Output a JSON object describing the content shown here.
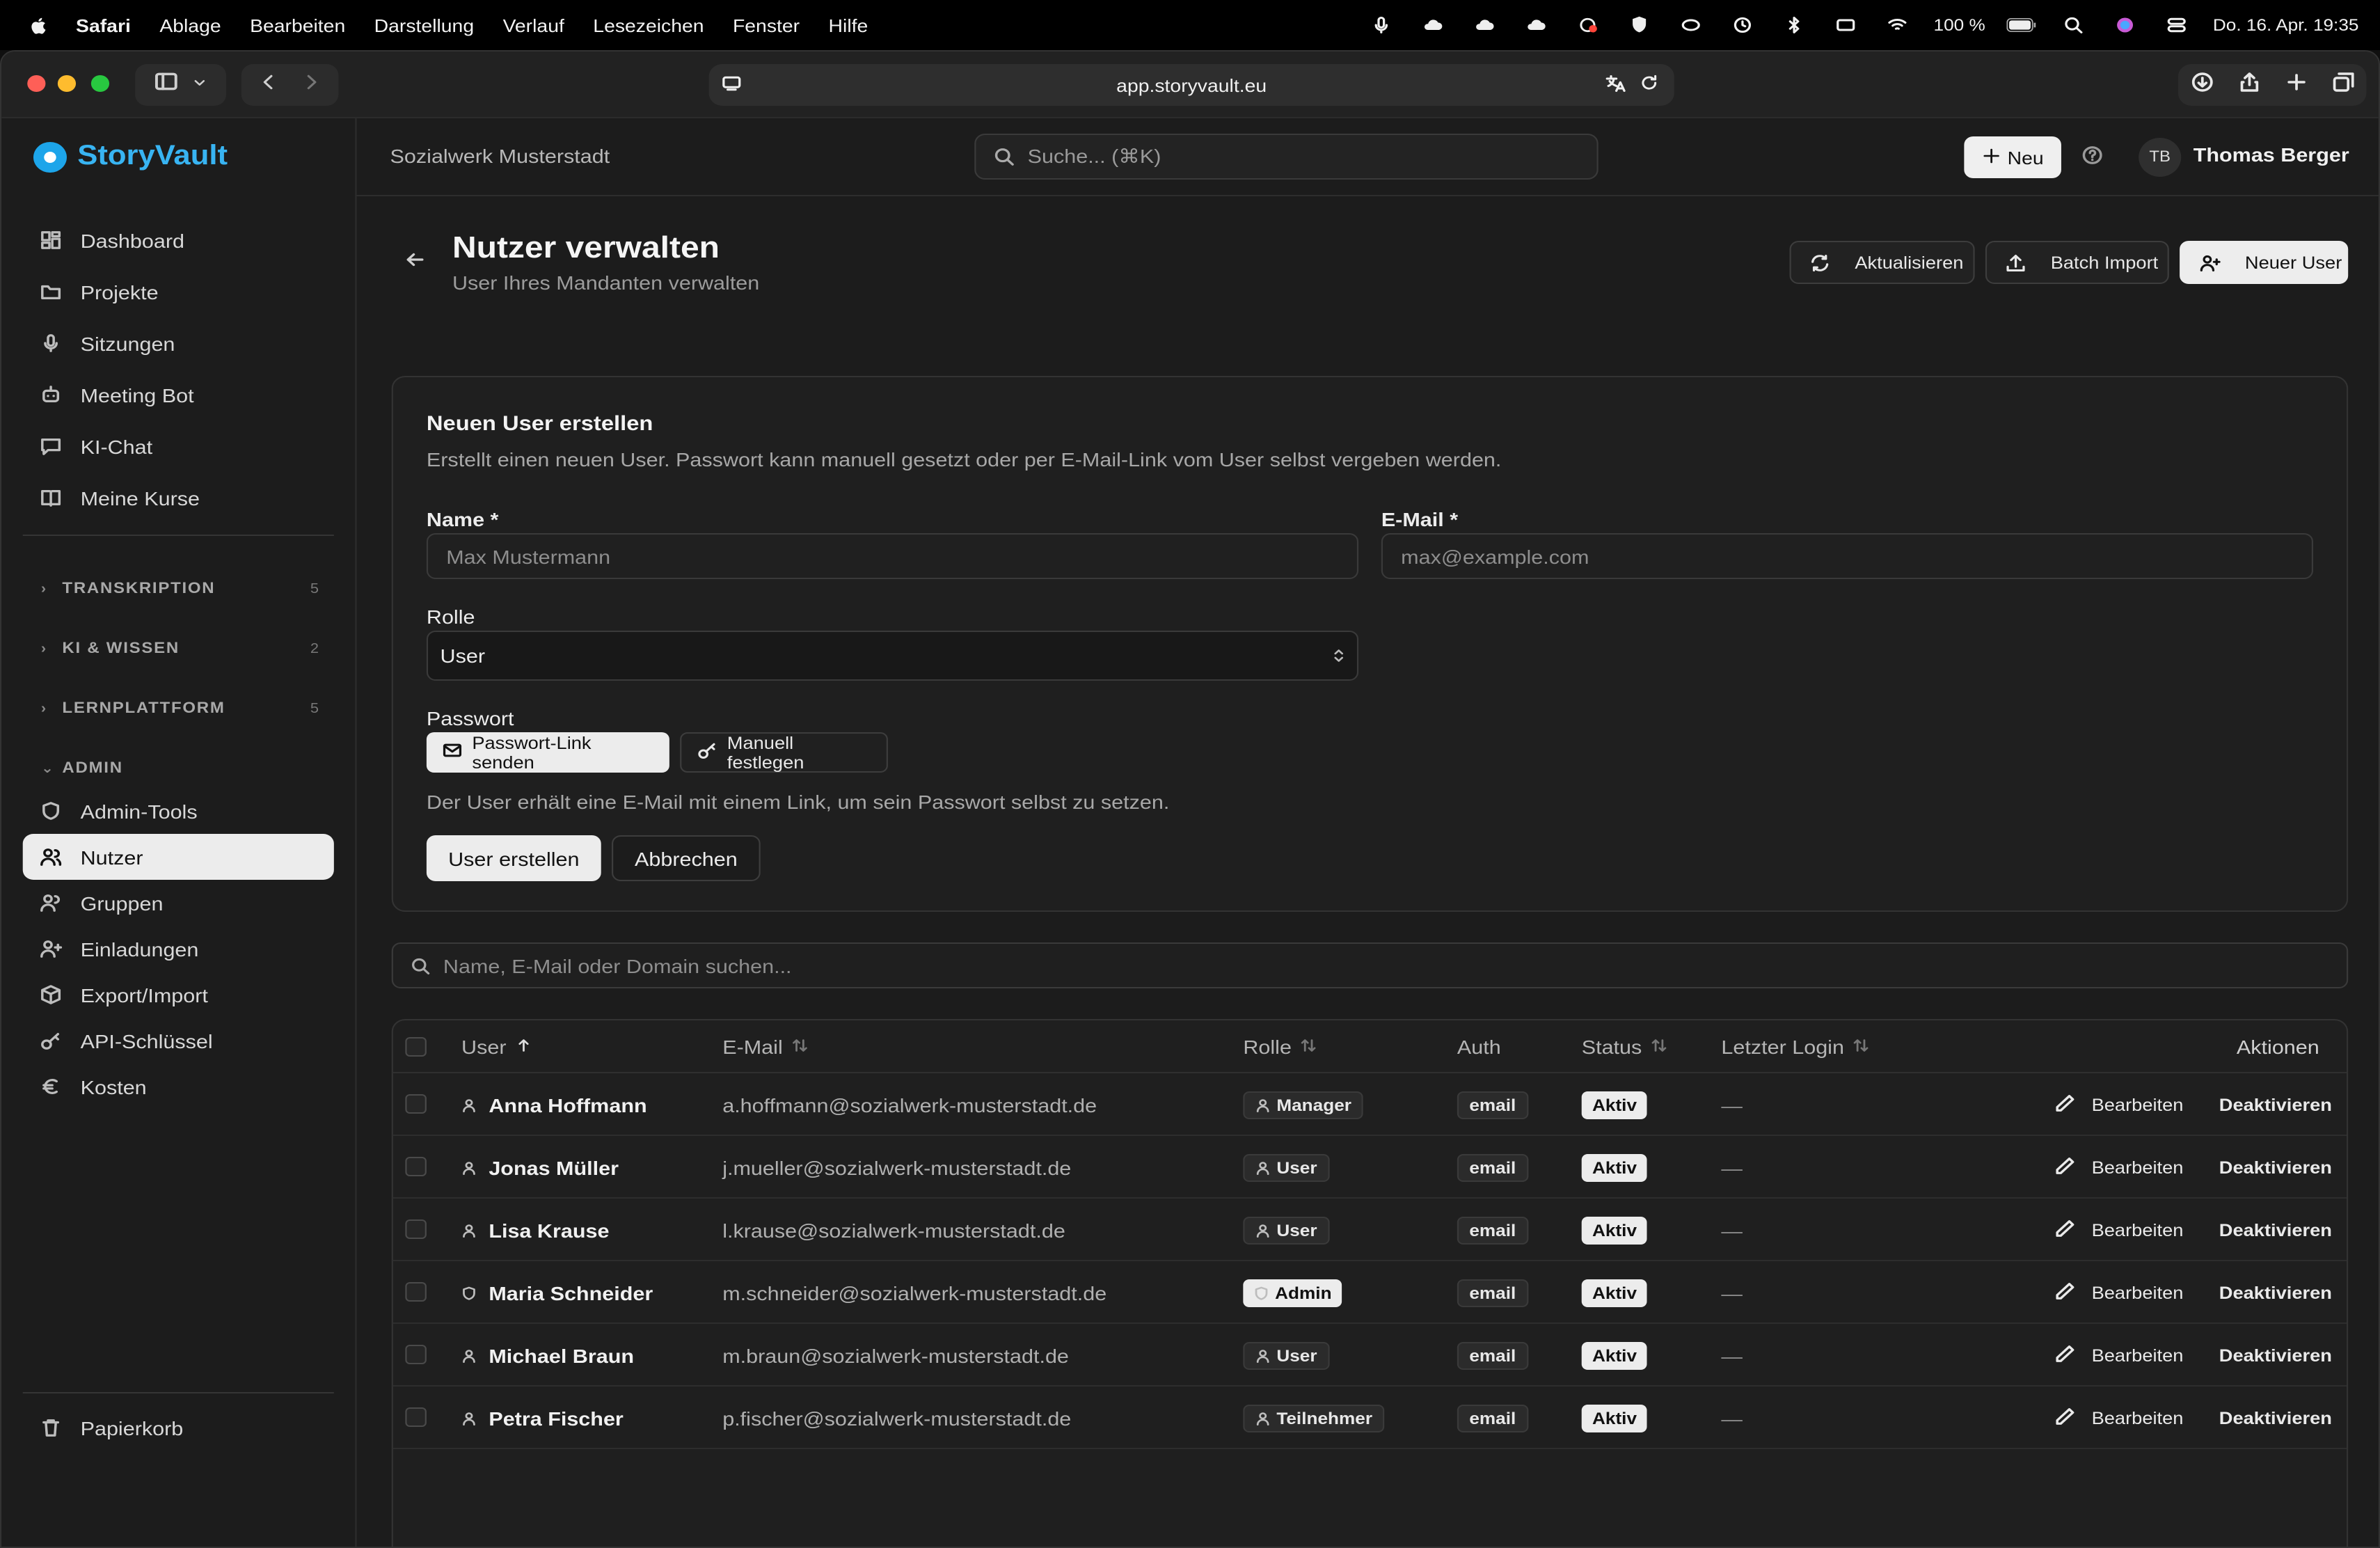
{
  "menubar": {
    "app": "Safari",
    "menus": [
      "Ablage",
      "Bearbeiten",
      "Darstellung",
      "Verlauf",
      "Lesezeichen",
      "Fenster",
      "Hilfe"
    ],
    "battery": "100 %",
    "datetime": "Do. 16. Apr.  19:35"
  },
  "browser": {
    "url": "app.storyvault.eu"
  },
  "brand": {
    "name": "StoryVault"
  },
  "sidebar": {
    "items": [
      {
        "label": "Dashboard",
        "icon": "dashboard-icon"
      },
      {
        "label": "Projekte",
        "icon": "folder-icon"
      },
      {
        "label": "Sitzungen",
        "icon": "mic-icon"
      },
      {
        "label": "Meeting Bot",
        "icon": "bot-icon"
      },
      {
        "label": "KI-Chat",
        "icon": "chat-icon"
      },
      {
        "label": "Meine Kurse",
        "icon": "book-icon"
      }
    ],
    "sections": [
      {
        "label": "TRANSKRIPTION",
        "count": "5"
      },
      {
        "label": "KI & WISSEN",
        "count": "2"
      },
      {
        "label": "LERNPLATTFORM",
        "count": "5"
      }
    ],
    "admin_label": "ADMIN",
    "admin_items": [
      {
        "label": "Admin-Tools",
        "icon": "shield-icon"
      },
      {
        "label": "Nutzer",
        "icon": "users-icon"
      },
      {
        "label": "Gruppen",
        "icon": "group-icon"
      },
      {
        "label": "Einladungen",
        "icon": "user-plus-icon"
      },
      {
        "label": "Export/Import",
        "icon": "package-icon"
      },
      {
        "label": "API-Schlüssel",
        "icon": "key-icon"
      },
      {
        "label": "Kosten",
        "icon": "euro-icon"
      }
    ],
    "trash": "Papierkorb"
  },
  "header": {
    "org": "Sozialwerk Musterstadt",
    "search_placeholder": "Suche... (⌘K)",
    "new_label": "Neu",
    "initials": "TB",
    "user": "Thomas Berger"
  },
  "page": {
    "title": "Nutzer verwalten",
    "subtitle": "User Ihres Mandanten verwalten",
    "refresh": "Aktualisieren",
    "batch": "Batch Import",
    "new_user": "Neuer User"
  },
  "form": {
    "title": "Neuen User erstellen",
    "desc": "Erstellt einen neuen User. Passwort kann manuell gesetzt oder per E-Mail-Link vom User selbst vergeben werden.",
    "name_label": "Name *",
    "name_placeholder": "Max Mustermann",
    "email_label": "E-Mail *",
    "email_placeholder": "max@example.com",
    "role_label": "Rolle",
    "role_value": "User",
    "pw_label": "Passwort",
    "pw_link": "Passwort-Link senden",
    "pw_manual": "Manuell festlegen",
    "pw_hint": "Der User erhält eine E-Mail mit einem Link, um sein Passwort selbst zu setzen.",
    "submit": "User erstellen",
    "cancel": "Abbrechen"
  },
  "table": {
    "search_placeholder": "Name, E-Mail oder Domain suchen...",
    "headers": {
      "user": "User",
      "email": "E-Mail",
      "role": "Rolle",
      "auth": "Auth",
      "status": "Status",
      "login": "Letzter Login",
      "actions": "Aktionen"
    },
    "rows": [
      {
        "name": "Anna Hoffmann",
        "email": "a.hoffmann@sozialwerk-musterstadt.de",
        "role": "Manager",
        "auth": "email",
        "status": "Aktiv",
        "login": "—",
        "edit": "Bearbeiten",
        "deactivate": "Deaktivieren"
      },
      {
        "name": "Jonas Müller",
        "email": "j.mueller@sozialwerk-musterstadt.de",
        "role": "User",
        "auth": "email",
        "status": "Aktiv",
        "login": "—",
        "edit": "Bearbeiten",
        "deactivate": "Deaktivieren"
      },
      {
        "name": "Lisa Krause",
        "email": "l.krause@sozialwerk-musterstadt.de",
        "role": "User",
        "auth": "email",
        "status": "Aktiv",
        "login": "—",
        "edit": "Bearbeiten",
        "deactivate": "Deaktivieren"
      },
      {
        "name": "Maria Schneider",
        "email": "m.schneider@sozialwerk-musterstadt.de",
        "role": "Admin",
        "auth": "email",
        "status": "Aktiv",
        "login": "—",
        "edit": "Bearbeiten",
        "deactivate": "Deaktivieren"
      },
      {
        "name": "Michael Braun",
        "email": "m.braun@sozialwerk-musterstadt.de",
        "role": "User",
        "auth": "email",
        "status": "Aktiv",
        "login": "—",
        "edit": "Bearbeiten",
        "deactivate": "Deaktivieren"
      },
      {
        "name": "Petra Fischer",
        "email": "p.fischer@sozialwerk-musterstadt.de",
        "role": "Teilnehmer",
        "auth": "email",
        "status": "Aktiv",
        "login": "—",
        "edit": "Bearbeiten",
        "deactivate": "Deaktivieren"
      }
    ]
  },
  "colors": {
    "accent": "#1da5ea",
    "background": "#1c1c1c"
  }
}
